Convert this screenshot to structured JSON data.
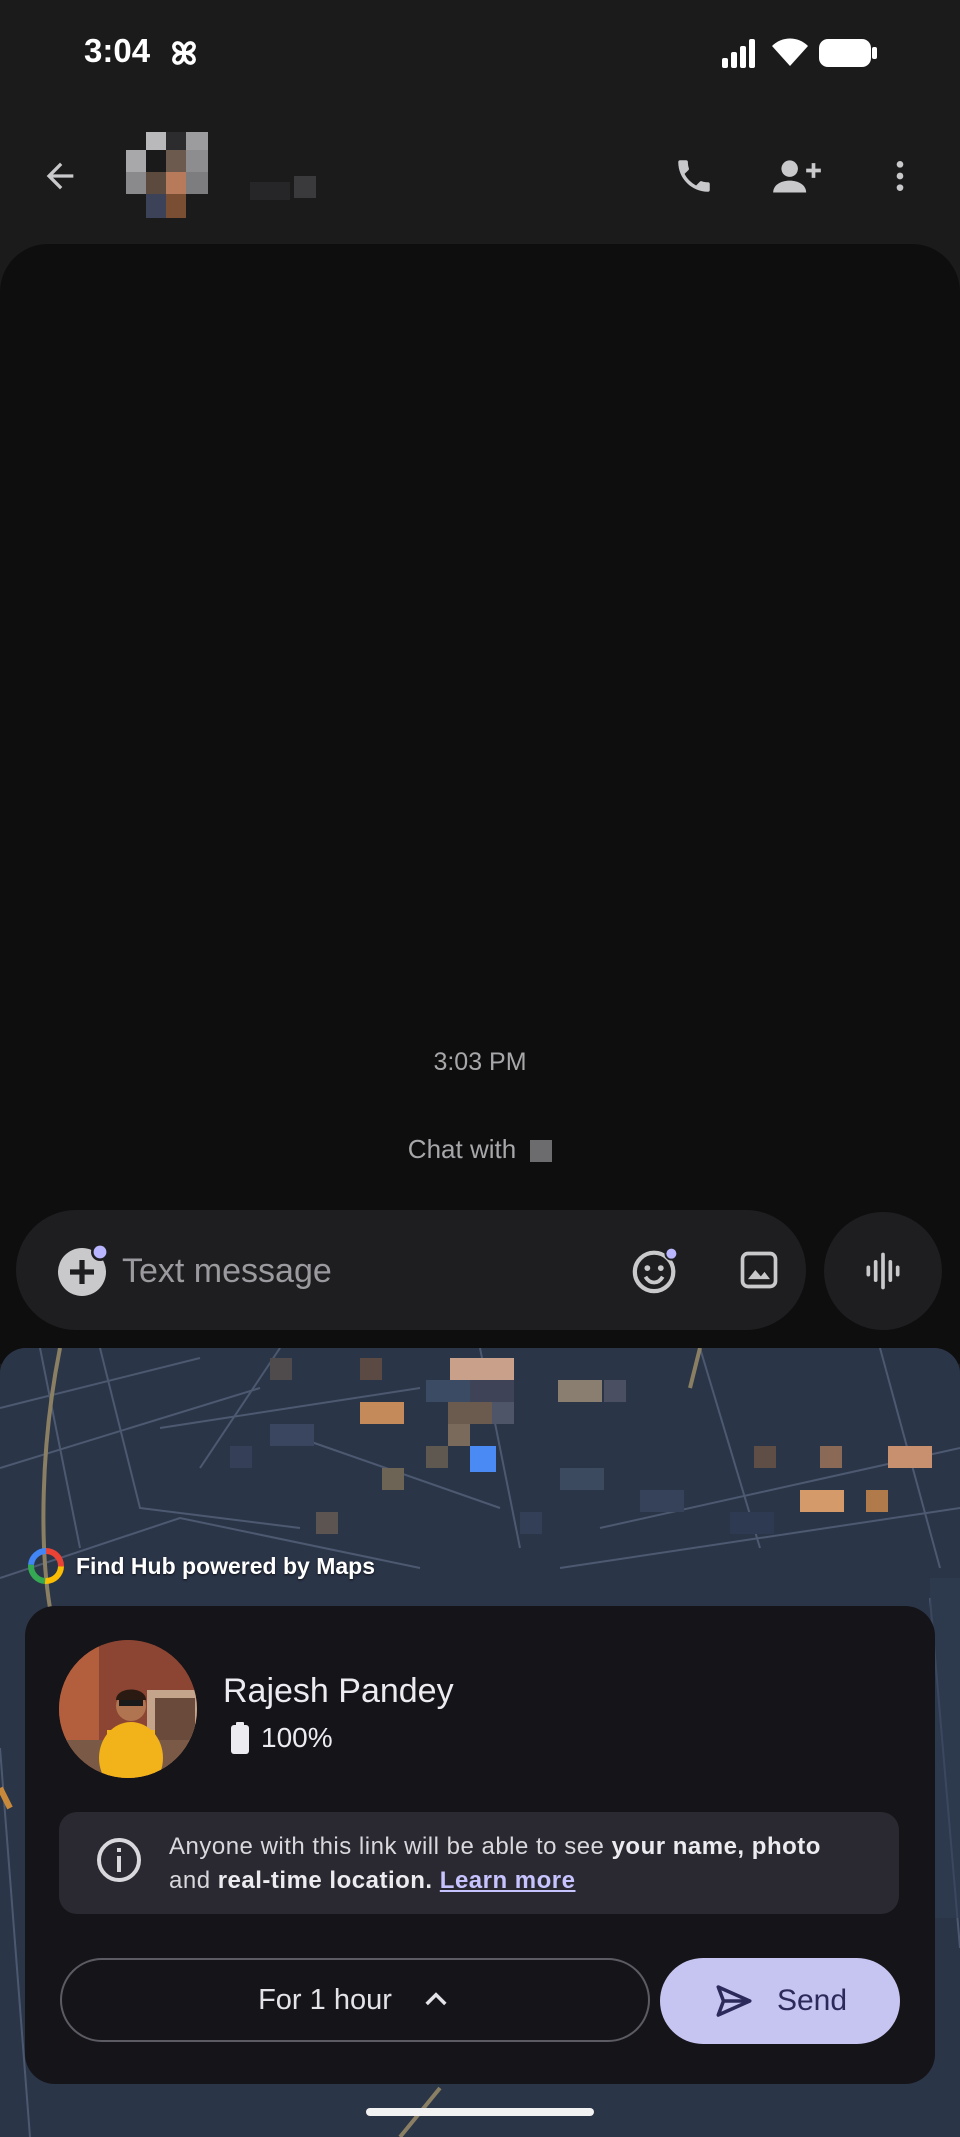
{
  "status_bar": {
    "time": "3:04"
  },
  "conversation": {
    "timestamp": "3:03 PM",
    "chat_with_label": "Chat with"
  },
  "compose": {
    "placeholder": "Text message"
  },
  "location_share": {
    "map_attribution": "Find Hub powered by Maps",
    "user_name": "Rajesh Pandey",
    "battery": "100%",
    "privacy_intro": "Anyone with this link will be able to see ",
    "privacy_bold_1": "your name,",
    "privacy_bold_2": "photo",
    "privacy_and": " and ",
    "privacy_bold_3": "real-time location.",
    "learn_more": "Learn more",
    "duration": "For 1 hour",
    "send": "Send"
  },
  "colors": {
    "background": "#1b1b1c",
    "conversation_bg": "#0e0e0f",
    "card_bg": "#151419",
    "send_button": "#c6c4f0",
    "link": "#c7c3ff"
  },
  "icons": [
    "pinwheel-icon",
    "signal-icon",
    "wifi-icon",
    "battery-icon",
    "back-arrow-icon",
    "phone-icon",
    "add-person-icon",
    "more-vert-icon",
    "add-attachment-icon",
    "emoji-icon",
    "image-icon",
    "voice-waveform-icon",
    "maps-logo-icon",
    "battery-status-icon",
    "info-icon",
    "chevron-up-icon",
    "send-icon"
  ]
}
